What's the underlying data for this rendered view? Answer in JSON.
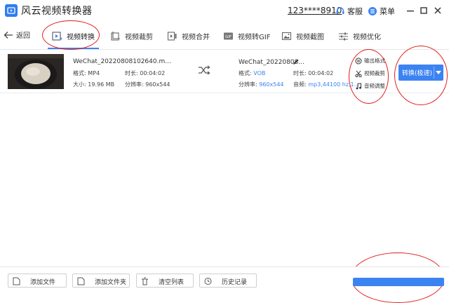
{
  "app": {
    "title": "风云视频转换器",
    "account": "123****8910",
    "service_label": "客服",
    "menu_label": "菜单"
  },
  "nav": {
    "back_label": "返回",
    "tabs": [
      {
        "label": "视频转换",
        "icon": "video-convert-icon",
        "active": true
      },
      {
        "label": "视频裁剪",
        "icon": "crop-icon"
      },
      {
        "label": "视频合并",
        "icon": "merge-icon"
      },
      {
        "label": "视频转GIF",
        "icon": "gif-icon"
      },
      {
        "label": "视频截图",
        "icon": "screenshot-icon"
      },
      {
        "label": "视频优化",
        "icon": "sliders-icon"
      }
    ]
  },
  "file": {
    "source": {
      "name": "WeChat_20220808102640.m...",
      "format_label": "格式:",
      "format_value": "MP4",
      "duration_label": "时长:",
      "duration_value": "00:04:02",
      "size_label": "大小:",
      "size_value": "19.96 MB",
      "resolution_label": "分辨率:",
      "resolution_value": "960x544"
    },
    "target": {
      "name": "WeChat_20220808...",
      "format_label": "格式:",
      "format_value": "VOB",
      "duration_label": "时长:",
      "duration_value": "00:04:02",
      "resolution_label": "分辨率:",
      "resolution_value": "960x544",
      "audio_label": "音频:",
      "audio_value": "mp3,44100 hz,1..."
    },
    "actions": [
      {
        "label": "输出格式",
        "icon": "output-format-icon"
      },
      {
        "label": "视频裁剪",
        "icon": "scissors-icon"
      },
      {
        "label": "音频调整",
        "icon": "music-note-icon"
      }
    ],
    "convert_label": "转换(极速)"
  },
  "bottom": {
    "buttons": [
      {
        "label": "添加文件",
        "icon": "add-file-icon"
      },
      {
        "label": "添加文件夹",
        "icon": "add-folder-icon"
      },
      {
        "label": "清空列表",
        "icon": "trash-icon"
      },
      {
        "label": "历史记录",
        "icon": "history-icon"
      }
    ]
  },
  "colors": {
    "accent": "#3c83f2",
    "annotation": "#e21d1d"
  }
}
